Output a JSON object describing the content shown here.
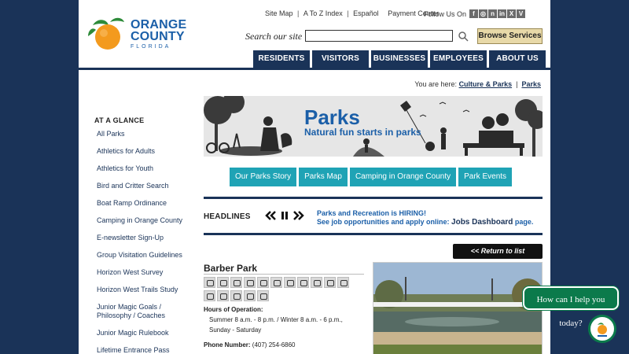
{
  "logo": {
    "line1": "ORANGE",
    "line2": "COUNTY",
    "line3": "FLORIDA"
  },
  "utility": {
    "site_map": "Site Map",
    "a_to_z": "A To Z Index",
    "espanol": "Español",
    "payment": "Payment Center",
    "follow": "Follow Us On"
  },
  "social_icons": [
    "facebook-icon",
    "instagram-icon",
    "nextdoor-icon",
    "linkedin-icon",
    "x-icon",
    "vimeo-icon"
  ],
  "search": {
    "label": "Search our site",
    "placeholder": ""
  },
  "browse": "Browse Services",
  "nav": [
    "RESIDENTS",
    "VISITORS",
    "BUSINESSES",
    "EMPLOYEES",
    "ABOUT US"
  ],
  "breadcrumb": {
    "prefix": "You are here:",
    "items": [
      "Culture & Parks",
      "Parks"
    ]
  },
  "sidebar": {
    "heading": "AT A GLANCE",
    "items": [
      "All Parks",
      "Athletics for Adults",
      "Athletics for Youth",
      "Bird and Critter Search",
      "Boat Ramp Ordinance",
      "Camping in Orange County",
      "E-newsletter Sign-Up",
      "Group Visitation Guidelines",
      "Horizon West Survey",
      "Horizon West Trails Study",
      "Junior Magic Goals / Philosophy / Coaches",
      "Junior Magic Rulebook",
      "Lifetime Entrance Pass"
    ]
  },
  "banner": {
    "title": "Parks",
    "subtitle": "Natural fun starts in parks"
  },
  "quick_links": [
    "Our Parks Story",
    "Parks Map",
    "Camping in Orange County",
    "Park Events"
  ],
  "headlines": {
    "label": "HEADLINES",
    "line1": "Parks and Recreation is HIRING!",
    "line2_prefix": "See job opportunities and apply online:",
    "line2_link": "Jobs Dashboard",
    "line2_suffix": "page."
  },
  "return_btn": "<< Return to list",
  "park": {
    "name": "Barber Park",
    "amenities": [
      "baseball-icon",
      "bench-icon",
      "dog-bone-icon",
      "fishing-icon",
      "heart-icon",
      "playground-icon",
      "dog-icon",
      "soccer-icon",
      "leaf-icon",
      "picnic-table-icon",
      "shelter-icon",
      "restroom-icon",
      "skate-icon",
      "volleyball-icon",
      "water-icon",
      "grill-icon"
    ],
    "hours_label": "Hours of Operation:",
    "hours_line1": "Summer 8 a.m. - 8 p.m. / Winter 8 a.m. - 6 p.m.,",
    "hours_line2": "Sunday - Saturday",
    "phone_label": "Phone Number:",
    "phone": "(407) 254-6860"
  },
  "chat": {
    "prompt": "How can I help you today?"
  }
}
